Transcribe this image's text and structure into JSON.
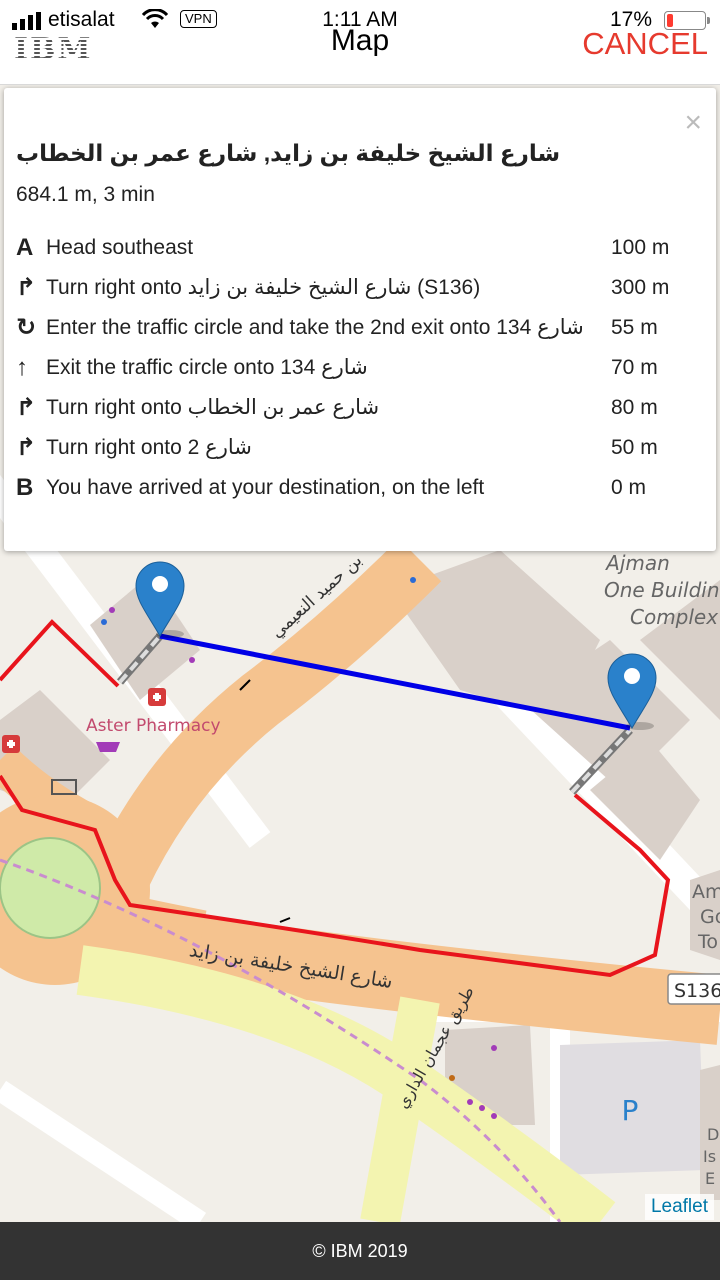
{
  "status_bar": {
    "carrier": "etisalat",
    "vpn": "VPN",
    "time": "1:11 AM",
    "battery": "17%",
    "battery_level": 0.17
  },
  "header": {
    "logo": "IBM",
    "title": "Map",
    "cancel": "CANCEL",
    "cancel_color": "#e63a2e"
  },
  "directions": {
    "close": "×",
    "route_name": "شارع الشيخ خليفة بن زايد, شارع عمر بن الخطاب",
    "summary": "684.1 m, 3 min",
    "steps": [
      {
        "icon": "start-marker-icon",
        "icon_text": "A",
        "text": "Head southeast",
        "distance": "100 m"
      },
      {
        "icon": "turn-right-icon",
        "icon_text": "↱",
        "text": "Turn right onto شارع الشيخ خليفة بن زايد (S136)",
        "distance": "300 m"
      },
      {
        "icon": "roundabout-icon",
        "icon_text": "↻",
        "text": "Enter the traffic circle and take the 2nd exit onto شارع 134",
        "distance": "55 m"
      },
      {
        "icon": "straight-arrow-icon",
        "icon_text": "↑",
        "text": "Exit the traffic circle onto شارع 134",
        "distance": "70 m"
      },
      {
        "icon": "turn-right-icon",
        "icon_text": "↱",
        "text": "Turn right onto شارع عمر بن الخطاب",
        "distance": "80 m"
      },
      {
        "icon": "turn-right-icon",
        "icon_text": "↱",
        "text": "Turn right onto شارع 2",
        "distance": "50 m"
      },
      {
        "icon": "end-marker-icon",
        "icon_text": "B",
        "text": "You have arrived at your destination, on the left",
        "distance": "0 m"
      }
    ]
  },
  "map": {
    "labels": {
      "pharmacy": "Aster Pharmacy",
      "building_1": "Ajman",
      "building_2": "One Buildin",
      "building_3": "Complex",
      "road_1": "شارع الشيخ خليفة بن زايد",
      "road_2": "بن حميد النعيمي",
      "road_3": "طريق عجمان الداري",
      "road_sign": "S136",
      "parking": "P",
      "partial_1": "Am",
      "partial_2": "Go",
      "partial_3": "To",
      "partial_4": "D",
      "partial_5": "Is",
      "partial_6": "E"
    },
    "route_color": "#e8141c",
    "line_color": "#0000e6",
    "marker_color": "#2a81cb",
    "attribution": "Leaflet"
  },
  "footer": {
    "copyright": "© IBM 2019"
  }
}
